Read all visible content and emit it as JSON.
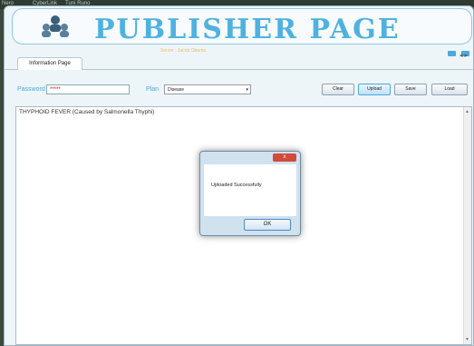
{
  "taskbar": {
    "items": [
      "Nero",
      "CyberLink",
      "Tuni Runo"
    ]
  },
  "header": {
    "title": "PUBLISHER PAGE"
  },
  "server_label": "Server : Jacob Obama",
  "tabs": [
    {
      "label": "Information Page"
    }
  ],
  "toolbar": {
    "password_label": "Password",
    "password_value": "*****",
    "plan_label": "Plan",
    "plan_selected": "Disease",
    "clear_label": "Clear",
    "upload_label": "Upload",
    "save_label": "Save",
    "load_label": "Load"
  },
  "content": {
    "text": "THYPHOID FEVER (Caused by Salmonella Thyphi)"
  },
  "dialog": {
    "message": "Uploaded Successfully",
    "ok_label": "OK",
    "close_label": "x"
  },
  "colors": {
    "accent": "#4aa8e0",
    "title": "#4fb1e0",
    "close": "#d24a3a",
    "password_text": "#cc0000"
  },
  "icons": {
    "logo": "network-users-icon"
  }
}
